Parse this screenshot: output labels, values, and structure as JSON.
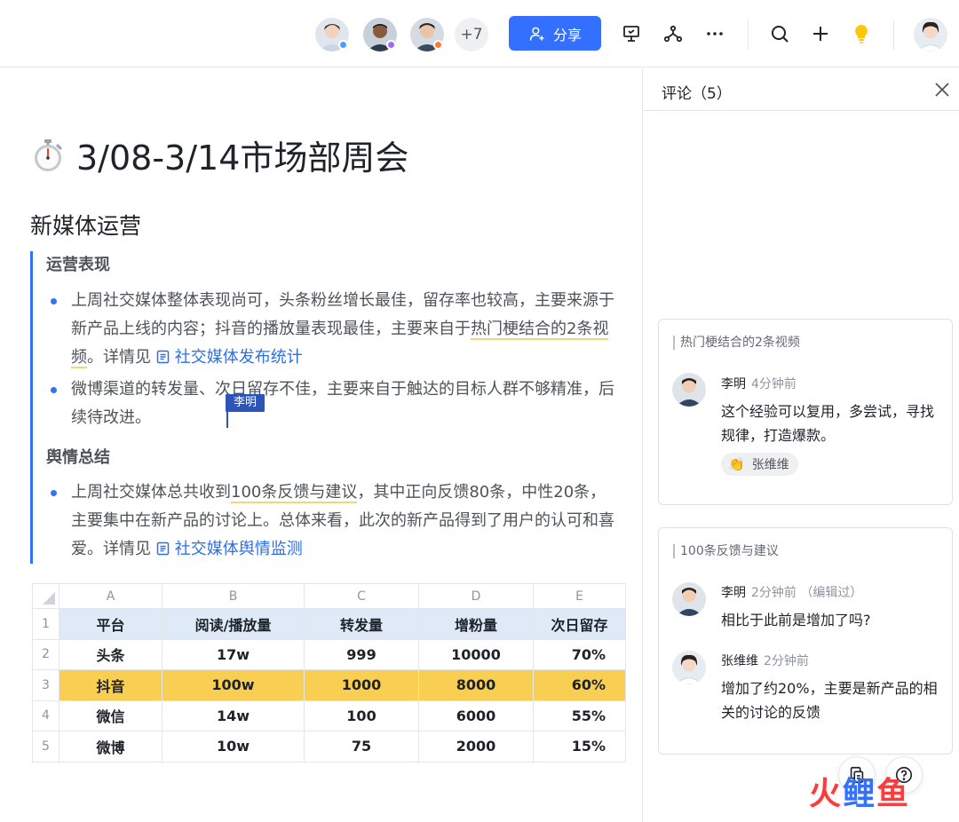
{
  "topbar": {
    "collaborators_more": "+7",
    "share_label": "分享",
    "colors": {
      "accent": "#3370ff",
      "presence_blue": "#4f9cff",
      "presence_purple": "#9f6cf7",
      "presence_orange": "#ff7a2e"
    }
  },
  "doc": {
    "title": "3/08-3/14市场部周会",
    "section_title": "新媒体运营",
    "sub1": "运营表现",
    "p1_a": "上周社交媒体整体表现尚可，头条粉丝增长最佳，留存率也较高，主要来源于新产品上线的内容；抖音的播放量表现最佳，主要来自于",
    "p1_hl": "热门梗结合的2条视频",
    "p1_b": "。详情见",
    "p1_link": "社交媒体发布统计",
    "p2": "微博渠道的转发量、次日留存不佳，主要来自于触达的目标人群不够精准，后续待改进。",
    "cursor_user": "李明",
    "sub2": "舆情总结",
    "p3_a": "上周社交媒体总共收到",
    "p3_hl": "100条反馈与建议",
    "p3_b": "，其中正向反馈80条，中性20条，主要集中在新产品的讨论上。总体来看，此次的新产品得到了用户的认可和喜爱。详情见",
    "p3_link": "社交媒体舆情监测"
  },
  "sheet": {
    "col_letters": [
      "A",
      "B",
      "C",
      "D",
      "E"
    ],
    "row_numbers": [
      "1",
      "2",
      "3",
      "4",
      "5"
    ],
    "header": [
      "平台",
      "阅读/播放量",
      "转发量",
      "增粉量",
      "次日留存"
    ],
    "rows": [
      [
        "头条",
        "17w",
        "999",
        "10000",
        "70%"
      ],
      [
        "抖音",
        "100w",
        "1000",
        "8000",
        "60%"
      ],
      [
        "微信",
        "14w",
        "100",
        "6000",
        "55%"
      ],
      [
        "微博",
        "10w",
        "75",
        "2000",
        "15%"
      ]
    ]
  },
  "panel": {
    "title": "评论（5）",
    "card1": {
      "quote": "热门梗结合的2条视频",
      "author": "李明",
      "time": "4分钟前",
      "text": "这个经验可以复用，多尝试，寻找规律，打造爆款。",
      "reaction_user": "张维维"
    },
    "card2": {
      "quote": "100条反馈与建议",
      "c1_author": "李明",
      "c1_time": "2分钟前 （编辑过）",
      "c1_text": "相比于此前是增加了吗?",
      "c2_author": "张维维",
      "c2_time": "2分钟前",
      "c2_text": "增加了约20%，主要是新产品的相关的讨论的反馈"
    }
  },
  "watermark": {
    "part1": "火",
    "part2": "鲤",
    "part3": "鱼"
  }
}
